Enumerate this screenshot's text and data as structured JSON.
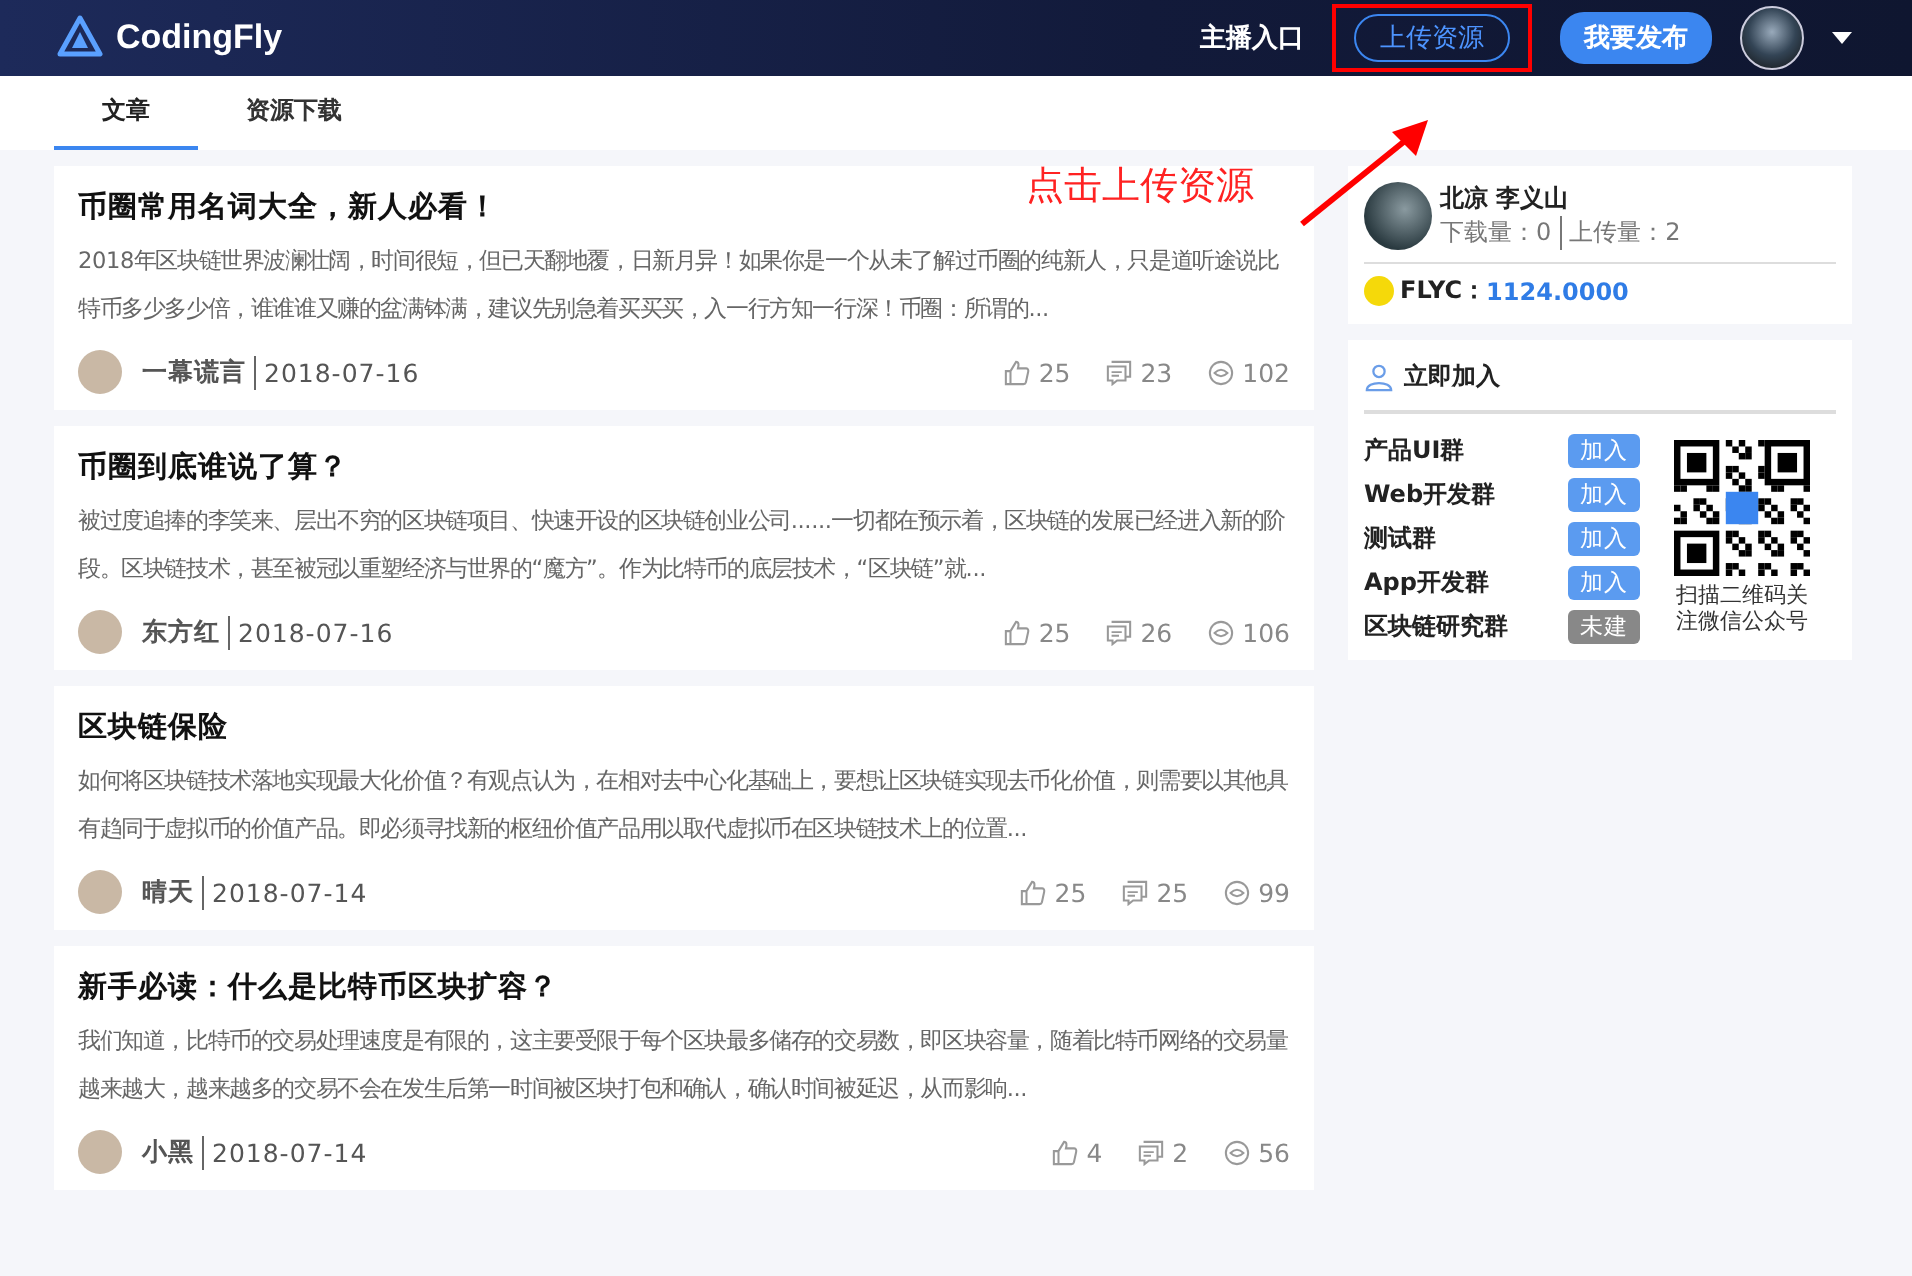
{
  "header": {
    "logo": "CodingFly",
    "links": [
      {
        "label": "主播入口",
        "kind": "text",
        "highlighted": false
      },
      {
        "label": "上传资源",
        "kind": "outline",
        "highlighted": true
      },
      {
        "label": "我要发布",
        "kind": "solid",
        "highlighted": false
      }
    ]
  },
  "tabs": [
    {
      "label": "文章",
      "selected": true
    },
    {
      "label": "资源下载",
      "selected": false
    }
  ],
  "annotation": {
    "text": "点击上传资源"
  },
  "articles": [
    {
      "title": "币圈常用名词大全，新人必看！",
      "excerpt": "2018年区块链世界波澜壮阔，时间很短，但已天翻地覆，日新月异！如果你是一个从未了解过币圈的纯新人，只是道听途说比特币多少多少倍，谁谁谁又赚的盆满钵满，建议先别急着买买买，入一行方知一行深！币圈：所谓的...",
      "author": "一幕谎言",
      "date": "2018-07-16",
      "likes": "25",
      "comments": "23",
      "views": "102"
    },
    {
      "title": "币圈到底谁说了算？",
      "excerpt": "被过度追捧的李笑来、层出不穷的区块链项目、快速开设的区块链创业公司......一切都在预示着，区块链的发展已经进入新的阶段。区块链技术，甚至被冠以重塑经济与世界的“魔方”。作为比特币的底层技术，“区块链”就...",
      "author": "东方红",
      "date": "2018-07-16",
      "likes": "25",
      "comments": "26",
      "views": "106"
    },
    {
      "title": "区块链保险",
      "excerpt": "如何将区块链技术落地实现最大化价值？有观点认为，在相对去中心化基础上，要想让区块链实现去币化价值，则需要以其他具有趋同于虚拟币的价值产品。即必须寻找新的枢纽价值产品用以取代虚拟币在区块链技术上的位置...",
      "author": "晴天",
      "date": "2018-07-14",
      "likes": "25",
      "comments": "25",
      "views": "99"
    },
    {
      "title": "新手必读：什么是比特币区块扩容？",
      "excerpt": "我们知道，比特币的交易处理速度是有限的，这主要受限于每个区块最多储存的交易数，即区块容量，随着比特币网络的交易量越来越大，越来越多的交易不会在发生后第一时间被区块打包和确认，确认时间被延迟，从而影响...",
      "author": "小黑",
      "date": "2018-07-14",
      "likes": "4",
      "comments": "2",
      "views": "56"
    }
  ],
  "profile": {
    "name": "北凉 李义山",
    "downloads": "下载量：0",
    "uploads": "上传量：2",
    "coin_label": "FLYC：",
    "coin_value": "1124.0000"
  },
  "groups": {
    "title": "立即加入",
    "items": [
      {
        "name": "产品UI群",
        "action": "加入",
        "available": true
      },
      {
        "name": "Web开发群",
        "action": "加入",
        "available": true
      },
      {
        "name": "测试群",
        "action": "加入",
        "available": true
      },
      {
        "name": "App开发群",
        "action": "加入",
        "available": true
      },
      {
        "name": "区块链研究群",
        "action": "未建",
        "available": false
      }
    ],
    "qr_caption": "扫描二维码关注微信公众号"
  }
}
